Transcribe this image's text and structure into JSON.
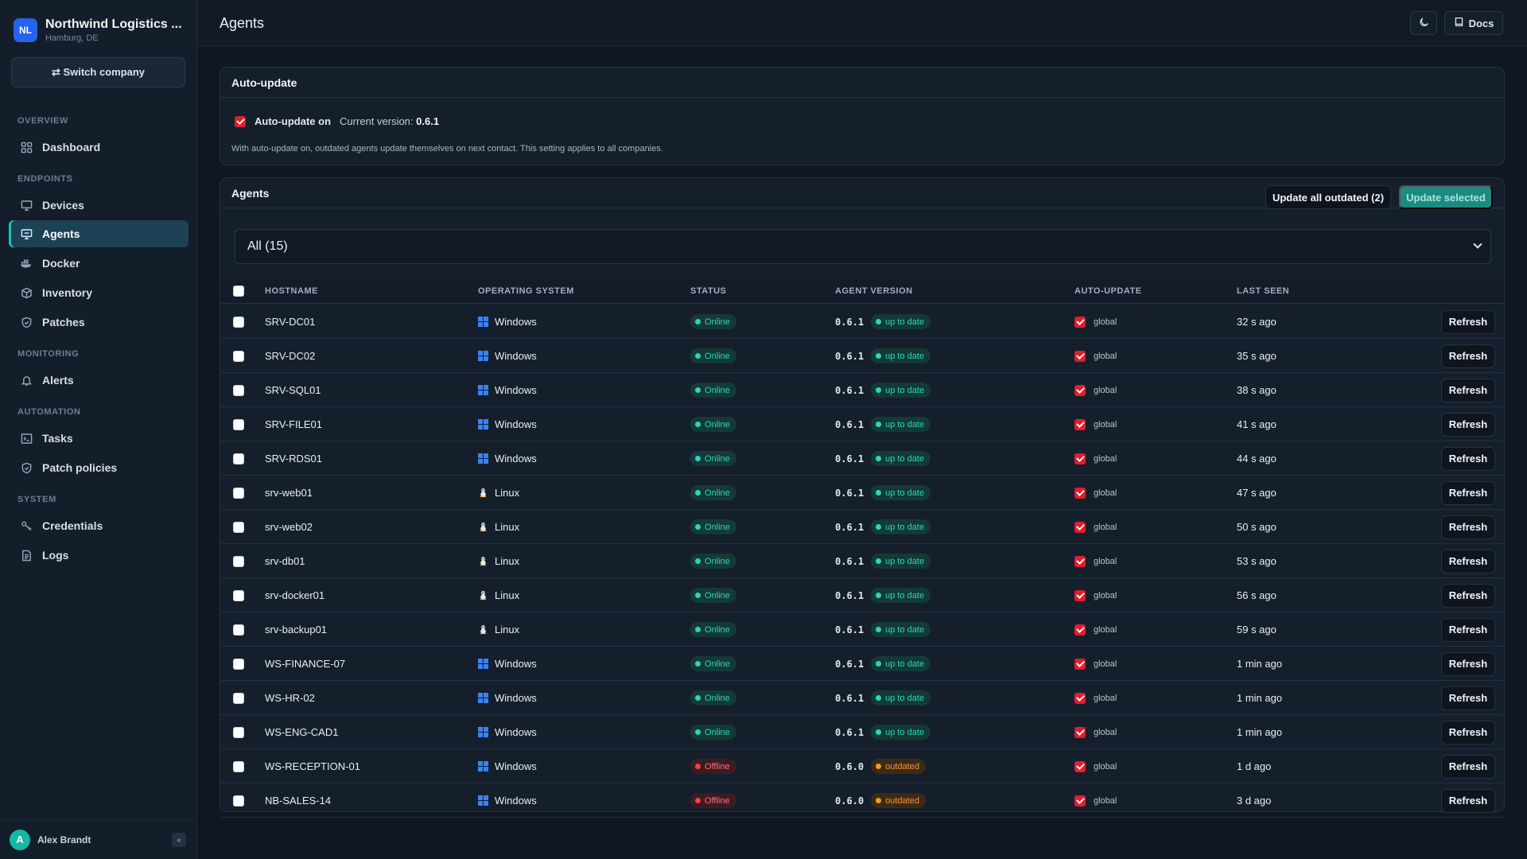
{
  "brand": {
    "initials": "NL",
    "name": "Northwind Logistics ...",
    "location": "Hamburg, DE"
  },
  "switch_company": {
    "icon": "swap-icon",
    "label": "⇄ Switch company"
  },
  "nav": {
    "sections": [
      {
        "label": "OVERVIEW",
        "items": [
          {
            "label": "Dashboard",
            "icon": "grid-icon"
          }
        ]
      },
      {
        "label": "ENDPOINTS",
        "items": [
          {
            "label": "Devices",
            "icon": "monitor-icon"
          },
          {
            "label": "Agents",
            "icon": "agent-icon",
            "active": true
          },
          {
            "label": "Docker",
            "icon": "docker-icon"
          },
          {
            "label": "Inventory",
            "icon": "box-icon"
          },
          {
            "label": "Patches",
            "icon": "shield-check-icon"
          }
        ]
      },
      {
        "label": "MONITORING",
        "items": [
          {
            "label": "Alerts",
            "icon": "bell-icon"
          }
        ]
      },
      {
        "label": "AUTOMATION",
        "items": [
          {
            "label": "Tasks",
            "icon": "terminal-icon"
          },
          {
            "label": "Patch policies",
            "icon": "shield-icon"
          }
        ]
      },
      {
        "label": "SYSTEM",
        "items": [
          {
            "label": "Credentials",
            "icon": "key-icon"
          },
          {
            "label": "Logs",
            "icon": "file-text-icon"
          }
        ]
      }
    ]
  },
  "user": {
    "initial": "A",
    "name": "Alex Brandt",
    "collapse": "«"
  },
  "header": {
    "title": "Agents",
    "theme_icon": "moon-icon",
    "docs_label": "Docs",
    "docs_icon": "book-icon"
  },
  "auto_update": {
    "title": "Auto-update",
    "checked": true,
    "label": "Auto-update on",
    "version_prefix": "Current version:",
    "version": "0.6.1",
    "note": "With auto-update on, outdated agents update themselves on next contact. This setting applies to all companies."
  },
  "agents": {
    "title": "Agents",
    "update_all_label": "Update all outdated (2)",
    "update_selected_label": "Update selected",
    "filter_value": "All (15)",
    "columns": [
      "HOSTNAME",
      "OPERATING SYSTEM",
      "STATUS",
      "AGENT VERSION",
      "AUTO-UPDATE",
      "LAST SEEN"
    ],
    "refresh_label": "Refresh",
    "rows": [
      {
        "hostname": "SRV-DC01",
        "os": "Windows",
        "status": "Online",
        "version": "0.6.1",
        "version_state": "up to date",
        "auto_update": "global",
        "last_seen": "32 s ago"
      },
      {
        "hostname": "SRV-DC02",
        "os": "Windows",
        "status": "Online",
        "version": "0.6.1",
        "version_state": "up to date",
        "auto_update": "global",
        "last_seen": "35 s ago"
      },
      {
        "hostname": "SRV-SQL01",
        "os": "Windows",
        "status": "Online",
        "version": "0.6.1",
        "version_state": "up to date",
        "auto_update": "global",
        "last_seen": "38 s ago"
      },
      {
        "hostname": "SRV-FILE01",
        "os": "Windows",
        "status": "Online",
        "version": "0.6.1",
        "version_state": "up to date",
        "auto_update": "global",
        "last_seen": "41 s ago"
      },
      {
        "hostname": "SRV-RDS01",
        "os": "Windows",
        "status": "Online",
        "version": "0.6.1",
        "version_state": "up to date",
        "auto_update": "global",
        "last_seen": "44 s ago"
      },
      {
        "hostname": "srv-web01",
        "os": "Linux",
        "status": "Online",
        "version": "0.6.1",
        "version_state": "up to date",
        "auto_update": "global",
        "last_seen": "47 s ago"
      },
      {
        "hostname": "srv-web02",
        "os": "Linux",
        "status": "Online",
        "version": "0.6.1",
        "version_state": "up to date",
        "auto_update": "global",
        "last_seen": "50 s ago"
      },
      {
        "hostname": "srv-db01",
        "os": "Linux",
        "status": "Online",
        "version": "0.6.1",
        "version_state": "up to date",
        "auto_update": "global",
        "last_seen": "53 s ago"
      },
      {
        "hostname": "srv-docker01",
        "os": "Linux",
        "status": "Online",
        "version": "0.6.1",
        "version_state": "up to date",
        "auto_update": "global",
        "last_seen": "56 s ago"
      },
      {
        "hostname": "srv-backup01",
        "os": "Linux",
        "status": "Online",
        "version": "0.6.1",
        "version_state": "up to date",
        "auto_update": "global",
        "last_seen": "59 s ago"
      },
      {
        "hostname": "WS-FINANCE-07",
        "os": "Windows",
        "status": "Online",
        "version": "0.6.1",
        "version_state": "up to date",
        "auto_update": "global",
        "last_seen": "1 min ago"
      },
      {
        "hostname": "WS-HR-02",
        "os": "Windows",
        "status": "Online",
        "version": "0.6.1",
        "version_state": "up to date",
        "auto_update": "global",
        "last_seen": "1 min ago"
      },
      {
        "hostname": "WS-ENG-CAD1",
        "os": "Windows",
        "status": "Online",
        "version": "0.6.1",
        "version_state": "up to date",
        "auto_update": "global",
        "last_seen": "1 min ago"
      },
      {
        "hostname": "WS-RECEPTION-01",
        "os": "Windows",
        "status": "Offline",
        "version": "0.6.0",
        "version_state": "outdated",
        "auto_update": "global",
        "last_seen": "1 d ago"
      },
      {
        "hostname": "NB-SALES-14",
        "os": "Windows",
        "status": "Offline",
        "version": "0.6.0",
        "version_state": "outdated",
        "auto_update": "global",
        "last_seen": "3 d ago"
      }
    ]
  },
  "colors": {
    "accent": "#1b8a80",
    "online": "#2dd4bf",
    "offline": "#ef4444",
    "outdated": "#f59e0b",
    "checkbox": "#e11d2e",
    "brand": "#2563eb"
  }
}
